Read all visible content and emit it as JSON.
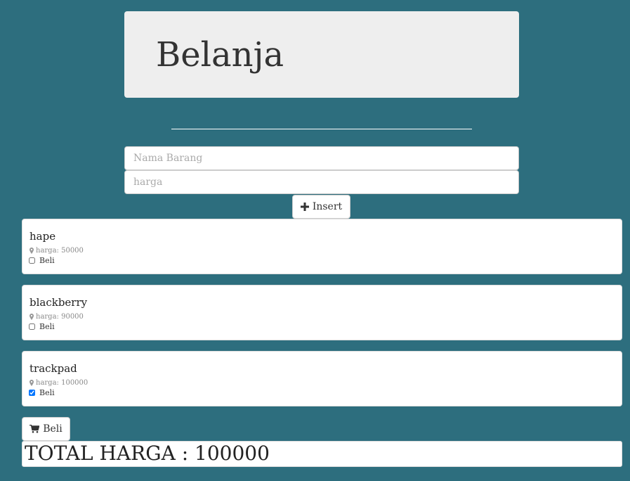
{
  "header": {
    "title": "Belanja"
  },
  "form": {
    "nama_placeholder": "Nama Barang",
    "harga_placeholder": "harga",
    "insert_label": "Insert"
  },
  "items": [
    {
      "name": "hape",
      "price": "harga: 50000",
      "buy_label": "Beli",
      "checked": false
    },
    {
      "name": "blackberry",
      "price": "harga: 90000",
      "buy_label": "Beli",
      "checked": false
    },
    {
      "name": "trackpad",
      "price": "harga: 100000",
      "buy_label": "Beli",
      "checked": true
    }
  ],
  "checkout": {
    "beli_label": "Beli"
  },
  "total": {
    "label": "TOTAL HARGA : ",
    "value": "100000"
  },
  "colors": {
    "background": "#2d6e7e",
    "jumbotron": "#eeeeee"
  },
  "icons": {
    "insert": "plus-icon",
    "price": "map-marker-icon",
    "cart": "shopping-cart-icon"
  }
}
